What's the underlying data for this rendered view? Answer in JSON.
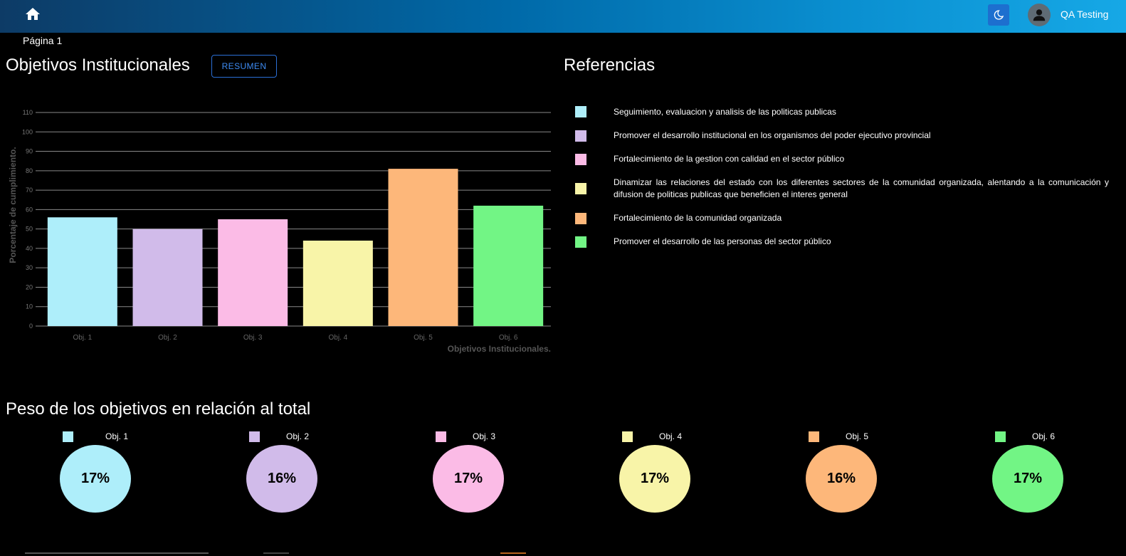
{
  "header": {
    "user_name": "QA Testing",
    "icons": {
      "home": "home-icon",
      "theme": "moon-icon",
      "avatar": "user-icon"
    }
  },
  "page_label": "Página 1",
  "objectives_section": {
    "title": "Objetivos Institucionales",
    "summary_button": "RESUMEN"
  },
  "references_section": {
    "title": "Referencias",
    "items": [
      {
        "color": "#aeeefa",
        "text": "Seguimiento, evaluacion y analisis de las politicas publicas"
      },
      {
        "color": "#d1bbea",
        "text": "Promover el desarrollo institucional en los organismos del poder ejecutivo provincial"
      },
      {
        "color": "#fbbbe6",
        "text": "Fortalecimiento de la gestion con calidad en el sector público"
      },
      {
        "color": "#f8f4a8",
        "text": "Dinamizar las relaciones del estado con los diferentes sectores de la comunidad organizada, alentando a la comunicación y difusion de politicas publicas que beneficien el interes general"
      },
      {
        "color": "#fdb77a",
        "text": "Fortalecimiento de la comunidad organizada"
      },
      {
        "color": "#72f585",
        "text": "Promover el desarrollo de las personas del sector público"
      }
    ]
  },
  "chart_data": {
    "type": "bar",
    "categories": [
      "Obj. 1",
      "Obj. 2",
      "Obj. 3",
      "Obj. 4",
      "Obj. 5",
      "Obj. 6"
    ],
    "values": [
      56,
      50,
      55,
      44,
      81,
      62
    ],
    "colors": [
      "#aeeefa",
      "#d1bbea",
      "#fbbbe6",
      "#f8f4a8",
      "#fdb77a",
      "#72f585"
    ],
    "xlabel": "Objetivos Institucionales.",
    "ylabel": "Porcentaje de cumplimiento.",
    "ylim": [
      0,
      110
    ],
    "yticks": [
      0,
      10,
      20,
      30,
      40,
      50,
      60,
      70,
      80,
      90,
      100,
      110
    ],
    "grid": true
  },
  "weights_section": {
    "title": "Peso de los objetivos en relación al total",
    "items": [
      {
        "label": "Obj. 1",
        "percent": "17%",
        "color": "#aeeefa"
      },
      {
        "label": "Obj. 2",
        "percent": "16%",
        "color": "#d1bbea"
      },
      {
        "label": "Obj. 3",
        "percent": "17%",
        "color": "#fbbbe6"
      },
      {
        "label": "Obj. 4",
        "percent": "17%",
        "color": "#f8f4a8"
      },
      {
        "label": "Obj. 5",
        "percent": "16%",
        "color": "#fdb77a"
      },
      {
        "label": "Obj. 6",
        "percent": "17%",
        "color": "#72f585"
      }
    ]
  }
}
